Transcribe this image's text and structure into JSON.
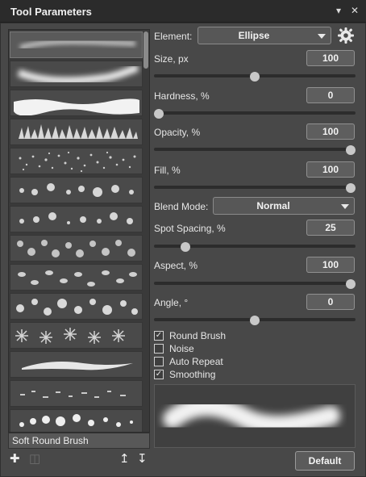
{
  "window": {
    "title": "Tool Parameters",
    "menu_icon": "chevron-down-icon",
    "close_icon": "close-icon"
  },
  "brush_list": {
    "selected_name": "Soft Round Brush",
    "presets": [
      {
        "icon": "soft-stroke-thumbnail"
      },
      {
        "icon": "soft-round-stroke-thumbnail"
      },
      {
        "icon": "wavy-band-thumbnail"
      },
      {
        "icon": "grass-thumbnail"
      },
      {
        "icon": "speckle-thumbnail"
      },
      {
        "icon": "spheres-thumbnail"
      },
      {
        "icon": "spheres-small-thumbnail"
      },
      {
        "icon": "flowers-thumbnail"
      },
      {
        "icon": "leaves-thumbnail"
      },
      {
        "icon": "hearts-thumbnail"
      },
      {
        "icon": "snowflakes-thumbnail"
      },
      {
        "icon": "ribbon-thumbnail"
      },
      {
        "icon": "sparks-thumbnail"
      },
      {
        "icon": "bubbles-thumbnail"
      }
    ],
    "scroll_position": 0
  },
  "footer": {
    "add_icon": "plus-icon",
    "delete_icon": "trash-icon",
    "import_icon": "upload-icon",
    "export_icon": "download-icon",
    "default_label": "Default"
  },
  "params": {
    "element_label": "Element:",
    "element_value": "Ellipse",
    "settings_icon": "gear-icon",
    "size_label": "Size, px",
    "size_value": "100",
    "size_level": 0.5,
    "hardness_label": "Hardness, %",
    "hardness_value": "0",
    "hardness_level": 0.0,
    "opacity_label": "Opacity, %",
    "opacity_value": "100",
    "opacity_level": 1.0,
    "fill_label": "Fill, %",
    "fill_value": "100",
    "fill_level": 1.0,
    "blend_label": "Blend Mode:",
    "blend_value": "Normal",
    "spacing_label": "Spot Spacing, %",
    "spacing_value": "25",
    "spacing_level": 0.14,
    "aspect_label": "Aspect, %",
    "aspect_value": "100",
    "aspect_level": 1.0,
    "angle_label": "Angle, °",
    "angle_value": "0",
    "angle_level": 0.5
  },
  "options": [
    {
      "label": "Round Brush",
      "checked": true
    },
    {
      "label": "Noise",
      "checked": false
    },
    {
      "label": "Auto Repeat",
      "checked": false
    },
    {
      "label": "Smoothing",
      "checked": true
    }
  ],
  "colors": {
    "panel_bg": "#484848",
    "titlebar_bg": "#2b2b2b",
    "control_bg": "#5e5e5e",
    "knob": "#c8c8c8"
  }
}
